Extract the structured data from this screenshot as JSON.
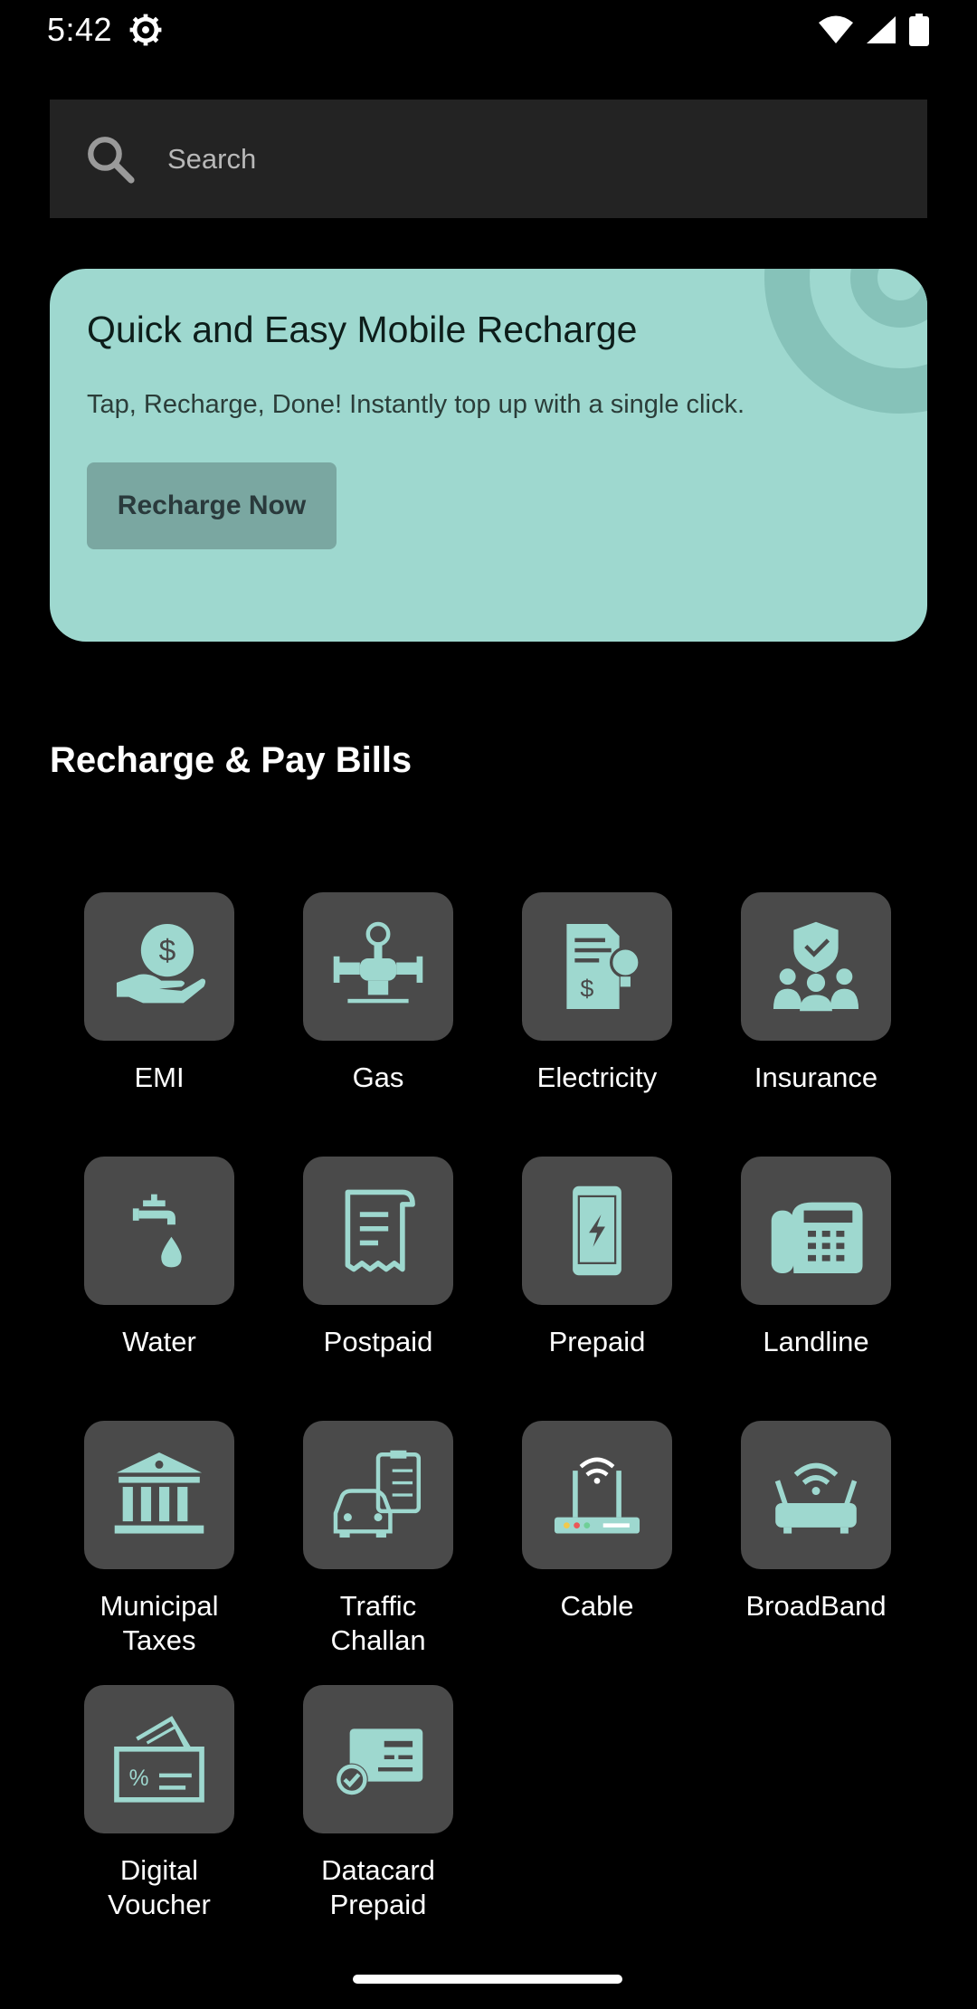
{
  "status_bar": {
    "time": "5:42",
    "icons": [
      "gear-icon",
      "wifi-icon",
      "signal-icon",
      "battery-icon"
    ]
  },
  "search": {
    "placeholder": "Search",
    "icon": "search-icon"
  },
  "promo": {
    "title": "Quick and Easy Mobile Recharge",
    "subtitle": "Tap, Recharge, Done! Instantly top up with a single click.",
    "button_label": "Recharge Now",
    "background_color": "#9ed8cf"
  },
  "section_title": "Recharge & Pay Bills",
  "services": [
    {
      "label": "EMI",
      "icon": "emi-icon"
    },
    {
      "label": "Gas",
      "icon": "gas-icon"
    },
    {
      "label": "Electricity",
      "icon": "electricity-icon"
    },
    {
      "label": "Insurance",
      "icon": "insurance-icon"
    },
    {
      "label": "Water",
      "icon": "water-icon"
    },
    {
      "label": "Postpaid",
      "icon": "postpaid-icon"
    },
    {
      "label": "Prepaid",
      "icon": "prepaid-icon"
    },
    {
      "label": "Landline",
      "icon": "landline-icon"
    },
    {
      "label": "Municipal\nTaxes",
      "icon": "municipal-icon"
    },
    {
      "label": "Traffic\nChallan",
      "icon": "traffic-challan-icon"
    },
    {
      "label": "Cable",
      "icon": "cable-icon"
    },
    {
      "label": "BroadBand",
      "icon": "broadband-icon"
    },
    {
      "label": "Digital\nVoucher",
      "icon": "digital-voucher-icon"
    },
    {
      "label": "Datacard\nPrepaid",
      "icon": "datacard-icon"
    }
  ],
  "colors": {
    "accent": "#9ed8cf",
    "tile_background": "#4a4a4a",
    "background": "#000000"
  }
}
